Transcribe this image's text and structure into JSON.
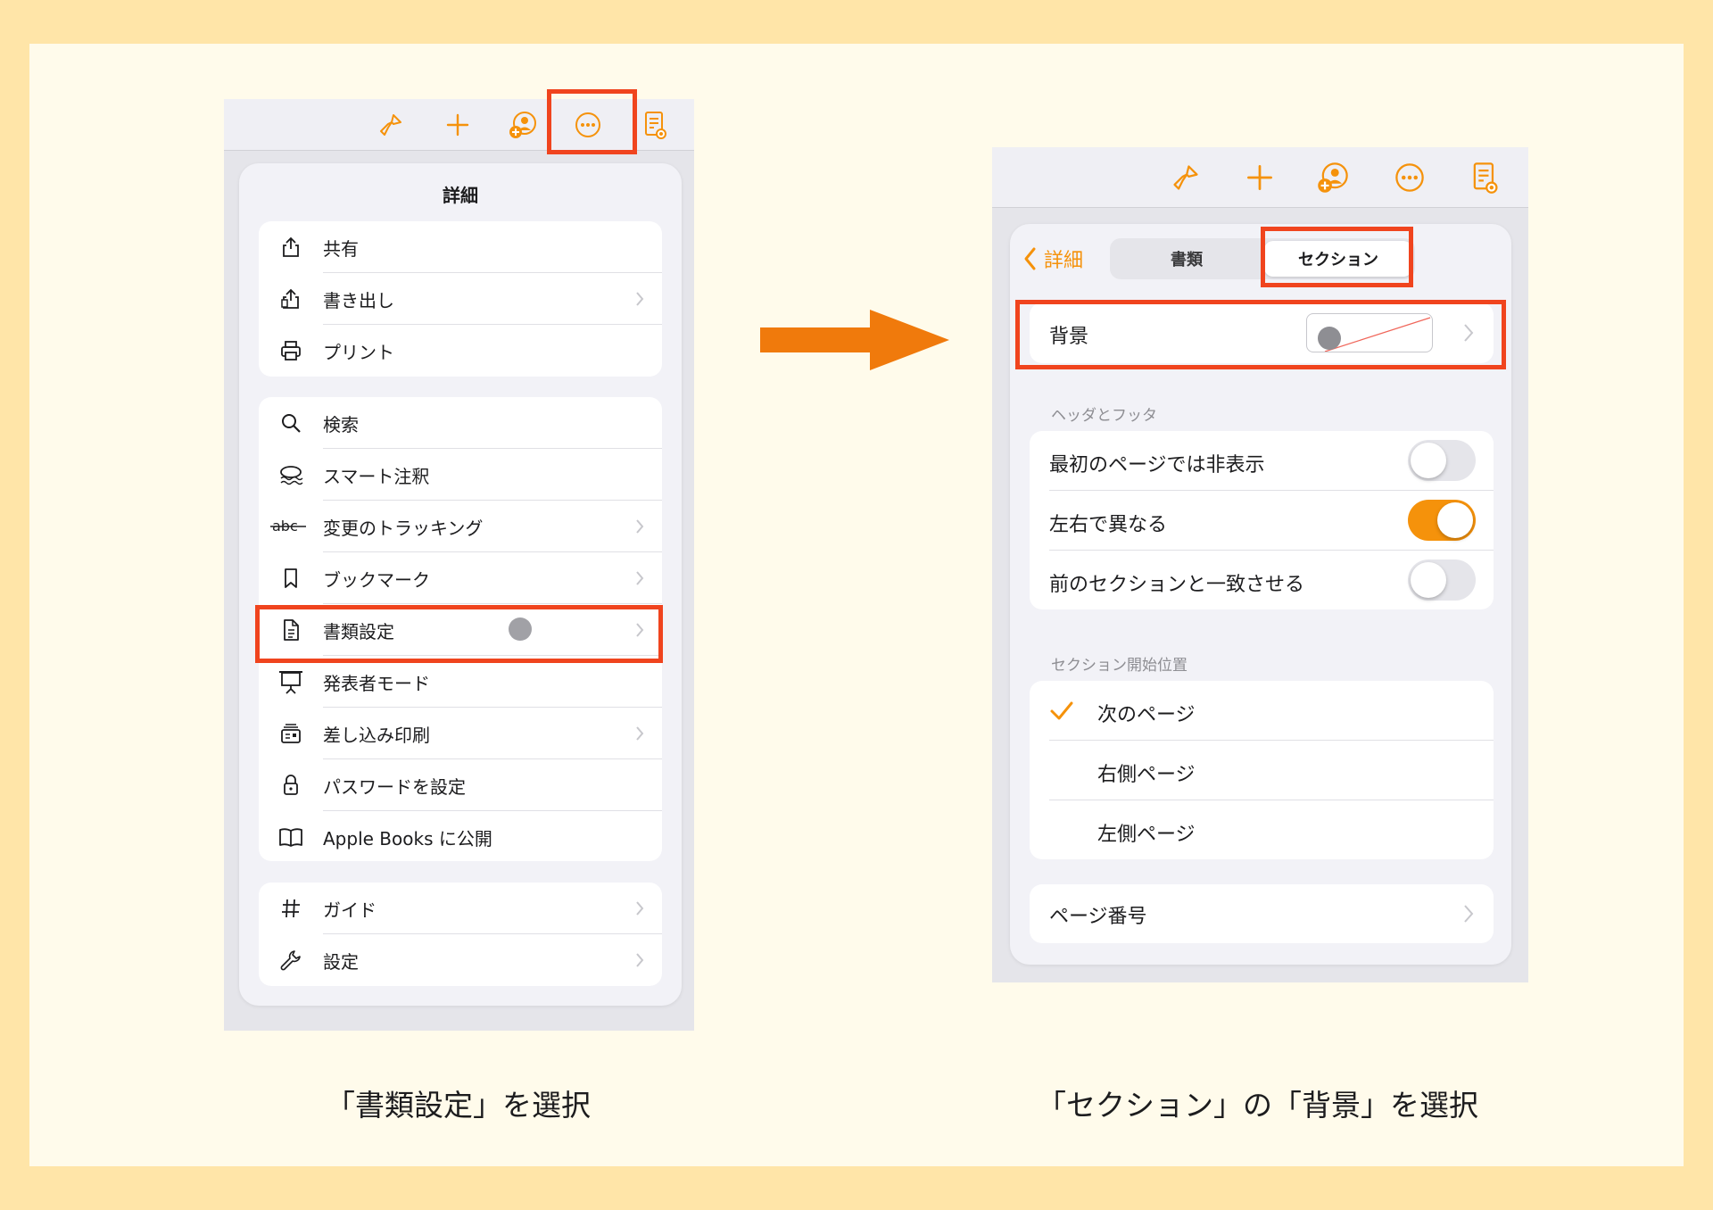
{
  "colors": {
    "accent": "#F5920B",
    "highlight": "#F0441E",
    "arrow": "#F07A0C"
  },
  "left": {
    "toolbar_icons": [
      "brush-icon",
      "plus-icon",
      "collaborate-icon",
      "more-icon",
      "document-view-icon"
    ],
    "popover_title": "詳細",
    "groups": [
      [
        {
          "icon": "share-icon",
          "label": "共有",
          "chevron": false
        },
        {
          "icon": "export-icon",
          "label": "書き出し",
          "chevron": true
        },
        {
          "icon": "print-icon",
          "label": "プリント",
          "chevron": false
        }
      ],
      [
        {
          "icon": "search-icon",
          "label": "検索",
          "chevron": false
        },
        {
          "icon": "smart-annotation-icon",
          "label": "スマート注釈",
          "chevron": false
        },
        {
          "icon": "track-changes-icon",
          "label": "変更のトラッキング",
          "chevron": true
        },
        {
          "icon": "bookmark-icon",
          "label": "ブックマーク",
          "chevron": true
        },
        {
          "icon": "document-icon",
          "label": "書類設定",
          "chevron": true
        },
        {
          "icon": "presenter-icon",
          "label": "発表者モード",
          "chevron": false
        },
        {
          "icon": "mail-merge-icon",
          "label": "差し込み印刷",
          "chevron": true
        },
        {
          "icon": "lock-icon",
          "label": "パスワードを設定",
          "chevron": false
        },
        {
          "icon": "book-icon",
          "label": "Apple Books に公開",
          "chevron": false
        }
      ],
      [
        {
          "icon": "grid-icon",
          "label": "ガイド",
          "chevron": true
        },
        {
          "icon": "wrench-icon",
          "label": "設定",
          "chevron": true
        }
      ]
    ],
    "caption": "「書類設定」を選択"
  },
  "right": {
    "back_label": "詳細",
    "tabs": [
      "書類",
      "セクション"
    ],
    "active_tab": "セクション",
    "background_label": "背景",
    "header_footer_title": "ヘッダとフッタ",
    "header_footer_rows": [
      {
        "label": "最初のページでは非表示",
        "on": false
      },
      {
        "label": "左右で異なる",
        "on": true
      },
      {
        "label": "前のセクションと一致させる",
        "on": false
      }
    ],
    "section_start_title": "セクション開始位置",
    "section_start_options": [
      {
        "label": "次のページ",
        "checked": true
      },
      {
        "label": "右側ページ",
        "checked": false
      },
      {
        "label": "左側ページ",
        "checked": false
      }
    ],
    "page_number_label": "ページ番号",
    "caption": "「セクション」の「背景」を選択"
  }
}
